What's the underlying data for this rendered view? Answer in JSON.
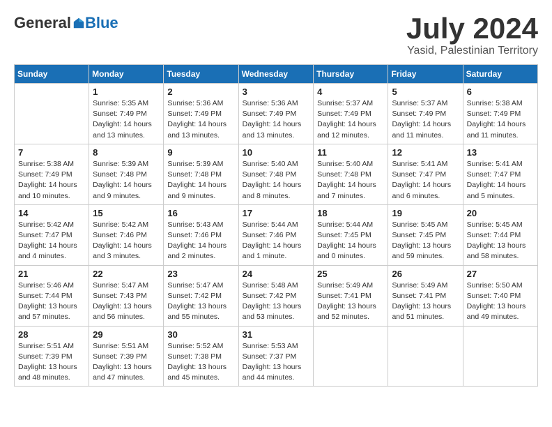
{
  "header": {
    "logo_general": "General",
    "logo_blue": "Blue",
    "month": "July 2024",
    "location": "Yasid, Palestinian Territory"
  },
  "days_of_week": [
    "Sunday",
    "Monday",
    "Tuesday",
    "Wednesday",
    "Thursday",
    "Friday",
    "Saturday"
  ],
  "weeks": [
    [
      {
        "day": "",
        "info": ""
      },
      {
        "day": "1",
        "info": "Sunrise: 5:35 AM\nSunset: 7:49 PM\nDaylight: 14 hours\nand 13 minutes."
      },
      {
        "day": "2",
        "info": "Sunrise: 5:36 AM\nSunset: 7:49 PM\nDaylight: 14 hours\nand 13 minutes."
      },
      {
        "day": "3",
        "info": "Sunrise: 5:36 AM\nSunset: 7:49 PM\nDaylight: 14 hours\nand 13 minutes."
      },
      {
        "day": "4",
        "info": "Sunrise: 5:37 AM\nSunset: 7:49 PM\nDaylight: 14 hours\nand 12 minutes."
      },
      {
        "day": "5",
        "info": "Sunrise: 5:37 AM\nSunset: 7:49 PM\nDaylight: 14 hours\nand 11 minutes."
      },
      {
        "day": "6",
        "info": "Sunrise: 5:38 AM\nSunset: 7:49 PM\nDaylight: 14 hours\nand 11 minutes."
      }
    ],
    [
      {
        "day": "7",
        "info": "Sunrise: 5:38 AM\nSunset: 7:49 PM\nDaylight: 14 hours\nand 10 minutes."
      },
      {
        "day": "8",
        "info": "Sunrise: 5:39 AM\nSunset: 7:48 PM\nDaylight: 14 hours\nand 9 minutes."
      },
      {
        "day": "9",
        "info": "Sunrise: 5:39 AM\nSunset: 7:48 PM\nDaylight: 14 hours\nand 9 minutes."
      },
      {
        "day": "10",
        "info": "Sunrise: 5:40 AM\nSunset: 7:48 PM\nDaylight: 14 hours\nand 8 minutes."
      },
      {
        "day": "11",
        "info": "Sunrise: 5:40 AM\nSunset: 7:48 PM\nDaylight: 14 hours\nand 7 minutes."
      },
      {
        "day": "12",
        "info": "Sunrise: 5:41 AM\nSunset: 7:47 PM\nDaylight: 14 hours\nand 6 minutes."
      },
      {
        "day": "13",
        "info": "Sunrise: 5:41 AM\nSunset: 7:47 PM\nDaylight: 14 hours\nand 5 minutes."
      }
    ],
    [
      {
        "day": "14",
        "info": "Sunrise: 5:42 AM\nSunset: 7:47 PM\nDaylight: 14 hours\nand 4 minutes."
      },
      {
        "day": "15",
        "info": "Sunrise: 5:42 AM\nSunset: 7:46 PM\nDaylight: 14 hours\nand 3 minutes."
      },
      {
        "day": "16",
        "info": "Sunrise: 5:43 AM\nSunset: 7:46 PM\nDaylight: 14 hours\nand 2 minutes."
      },
      {
        "day": "17",
        "info": "Sunrise: 5:44 AM\nSunset: 7:46 PM\nDaylight: 14 hours\nand 1 minute."
      },
      {
        "day": "18",
        "info": "Sunrise: 5:44 AM\nSunset: 7:45 PM\nDaylight: 14 hours\nand 0 minutes."
      },
      {
        "day": "19",
        "info": "Sunrise: 5:45 AM\nSunset: 7:45 PM\nDaylight: 13 hours\nand 59 minutes."
      },
      {
        "day": "20",
        "info": "Sunrise: 5:45 AM\nSunset: 7:44 PM\nDaylight: 13 hours\nand 58 minutes."
      }
    ],
    [
      {
        "day": "21",
        "info": "Sunrise: 5:46 AM\nSunset: 7:44 PM\nDaylight: 13 hours\nand 57 minutes."
      },
      {
        "day": "22",
        "info": "Sunrise: 5:47 AM\nSunset: 7:43 PM\nDaylight: 13 hours\nand 56 minutes."
      },
      {
        "day": "23",
        "info": "Sunrise: 5:47 AM\nSunset: 7:42 PM\nDaylight: 13 hours\nand 55 minutes."
      },
      {
        "day": "24",
        "info": "Sunrise: 5:48 AM\nSunset: 7:42 PM\nDaylight: 13 hours\nand 53 minutes."
      },
      {
        "day": "25",
        "info": "Sunrise: 5:49 AM\nSunset: 7:41 PM\nDaylight: 13 hours\nand 52 minutes."
      },
      {
        "day": "26",
        "info": "Sunrise: 5:49 AM\nSunset: 7:41 PM\nDaylight: 13 hours\nand 51 minutes."
      },
      {
        "day": "27",
        "info": "Sunrise: 5:50 AM\nSunset: 7:40 PM\nDaylight: 13 hours\nand 49 minutes."
      }
    ],
    [
      {
        "day": "28",
        "info": "Sunrise: 5:51 AM\nSunset: 7:39 PM\nDaylight: 13 hours\nand 48 minutes."
      },
      {
        "day": "29",
        "info": "Sunrise: 5:51 AM\nSunset: 7:39 PM\nDaylight: 13 hours\nand 47 minutes."
      },
      {
        "day": "30",
        "info": "Sunrise: 5:52 AM\nSunset: 7:38 PM\nDaylight: 13 hours\nand 45 minutes."
      },
      {
        "day": "31",
        "info": "Sunrise: 5:53 AM\nSunset: 7:37 PM\nDaylight: 13 hours\nand 44 minutes."
      },
      {
        "day": "",
        "info": ""
      },
      {
        "day": "",
        "info": ""
      },
      {
        "day": "",
        "info": ""
      }
    ]
  ]
}
